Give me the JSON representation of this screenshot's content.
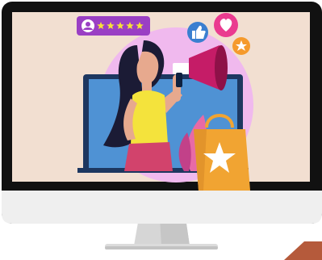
{
  "rating": {
    "stars": 5,
    "max": 5
  },
  "icons": [
    "user-icon",
    "star-icon",
    "thumbs-up-icon",
    "heart-icon",
    "megaphone-icon",
    "shopping-bag-icon",
    "laptop-icon"
  ],
  "colors": {
    "monitor_frame": "#111111",
    "screen_bg": "#f2dfd1",
    "bottom_bezel": "#efefef",
    "stand": "#d6d6d6",
    "laptop_blue": "#4f92d4",
    "laptop_dark": "#1d3760",
    "circle": "#f0b9ee",
    "rating_purple": "#9a3fc4",
    "star_yellow": "#f7e13a",
    "like_blue": "#3a7fd0",
    "heart_pink": "#ea3b8f",
    "badge_orange": "#f59a2c",
    "megaphone": "#c51c67",
    "bag_orange": "#f1a432",
    "shirt_yellow": "#f4e33c",
    "hair": "#1b1b35",
    "skin": "#e7a98e",
    "pants": "#d2436c"
  }
}
